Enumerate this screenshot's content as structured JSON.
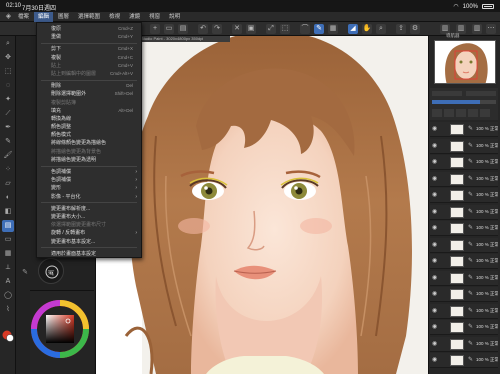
{
  "status": {
    "time": "02:10",
    "date": "7月30日週四",
    "battery": "100%"
  },
  "menubar": [
    "檔案",
    "編輯",
    "圖層",
    "選擇範圍",
    "檢視",
    "濾鏡",
    "視窗",
    "說明"
  ],
  "active_menu_index": 1,
  "document_tab": "Clip Studio Paint - 3020x4800px 350dpi",
  "edit_menu": {
    "items": [
      {
        "label": "復原",
        "shortcut": "Cmd+Z"
      },
      {
        "label": "重做",
        "shortcut": "Cmd+Y"
      },
      {
        "sep": true
      },
      {
        "label": "剪下",
        "shortcut": "Cmd+X"
      },
      {
        "label": "複製",
        "shortcut": "Cmd+C"
      },
      {
        "label": "貼上",
        "shortcut": "Cmd+V",
        "disabled": true
      },
      {
        "label": "貼上到編輯中的圖層",
        "shortcut": "Cmd+Alt+V",
        "disabled": true
      },
      {
        "sep": true
      },
      {
        "label": "刪除",
        "shortcut": "Del"
      },
      {
        "label": "刪除選擇範圍外",
        "shortcut": "Shift+Del"
      },
      {
        "label": "複製剪貼簿",
        "disabled": true
      },
      {
        "label": "填充",
        "shortcut": "Alt+Del"
      },
      {
        "label": "轉換為線",
        "shortcut": ""
      },
      {
        "label": "顏色調整",
        "shortcut": ""
      },
      {
        "label": "顏色模式",
        "shortcut": ""
      },
      {
        "label": "將線條顏色變更為描繪色",
        "shortcut": ""
      },
      {
        "label": "將描繪色變更為背景色",
        "shortcut": "",
        "disabled": true
      },
      {
        "label": "將描繪色變更為透明",
        "shortcut": ""
      },
      {
        "sep": true
      },
      {
        "label": "色調補償",
        "arrow": true
      },
      {
        "label": "色調補償",
        "arrow": true
      },
      {
        "label": "變形",
        "arrow": true
      },
      {
        "label": "影像 - 平台化",
        "arrow": true
      },
      {
        "sep": true
      },
      {
        "label": "變更畫布解析度..."
      },
      {
        "label": "變更畫布大小..."
      },
      {
        "label": "依選擇範圍變更畫布尺寸",
        "disabled": true
      },
      {
        "label": "旋轉 / 反轉畫布",
        "arrow": true
      },
      {
        "label": "變更畫布基本設定..."
      },
      {
        "sep": true
      },
      {
        "label": "適用於畫面基本設定"
      }
    ]
  },
  "layers": [
    {
      "name": "100 % 正常"
    },
    {
      "name": "100 % 正常"
    },
    {
      "name": "100 % 正常"
    },
    {
      "name": "100 % 正常"
    },
    {
      "name": "100 % 正常"
    },
    {
      "name": "100 % 正常"
    },
    {
      "name": "100 % 正常"
    },
    {
      "name": "100 % 正常"
    },
    {
      "name": "100 % 正常"
    },
    {
      "name": "100 % 正常"
    },
    {
      "name": "100 % 正常"
    },
    {
      "name": "100 % 正常"
    },
    {
      "name": "100 % 正常"
    },
    {
      "name": "100 % 正常"
    },
    {
      "name": "100 % 正常"
    }
  ],
  "navigator_label": "導航器",
  "colors": {
    "accent": "#3e6eb7",
    "hair": "#a0693f",
    "skin": "#f5d7c5",
    "iris": "#8d8a3a",
    "current_color": "#d83a26"
  }
}
